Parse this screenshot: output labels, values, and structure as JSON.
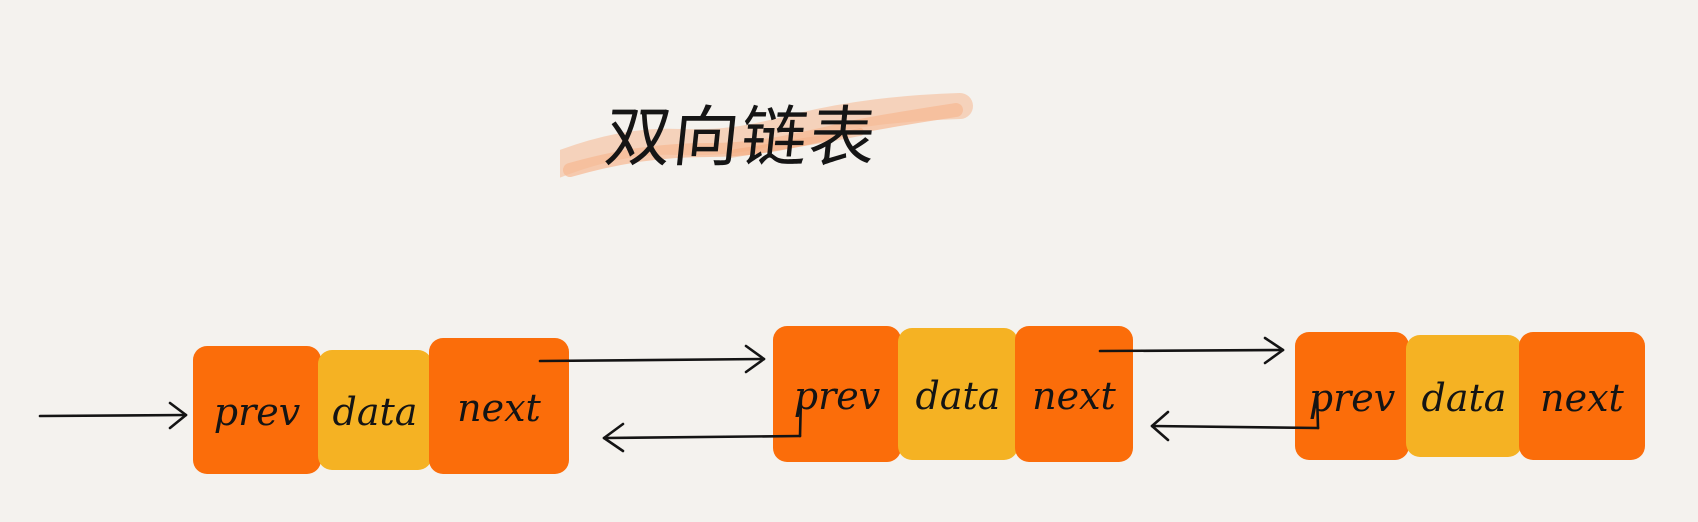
{
  "title": "双向链表",
  "colors": {
    "background": "#f4f2ee",
    "pointer_cell": "#fb6d0a",
    "data_cell": "#f5b223",
    "title_highlight": "#f6b891",
    "ink": "#141414"
  },
  "nodes": [
    {
      "prev": "prev",
      "data": "data",
      "next": "next"
    },
    {
      "prev": "prev",
      "data": "data",
      "next": "next"
    },
    {
      "prev": "prev",
      "data": "data",
      "next": "next"
    }
  ],
  "links": [
    {
      "from": "head",
      "to": "node-1",
      "direction": "forward"
    },
    {
      "from": "node-1.next",
      "to": "node-2",
      "direction": "forward"
    },
    {
      "from": "node-2.prev",
      "to": "node-1",
      "direction": "backward"
    },
    {
      "from": "node-2.next",
      "to": "node-3",
      "direction": "forward"
    },
    {
      "from": "node-3.prev",
      "to": "node-2",
      "direction": "backward"
    }
  ]
}
